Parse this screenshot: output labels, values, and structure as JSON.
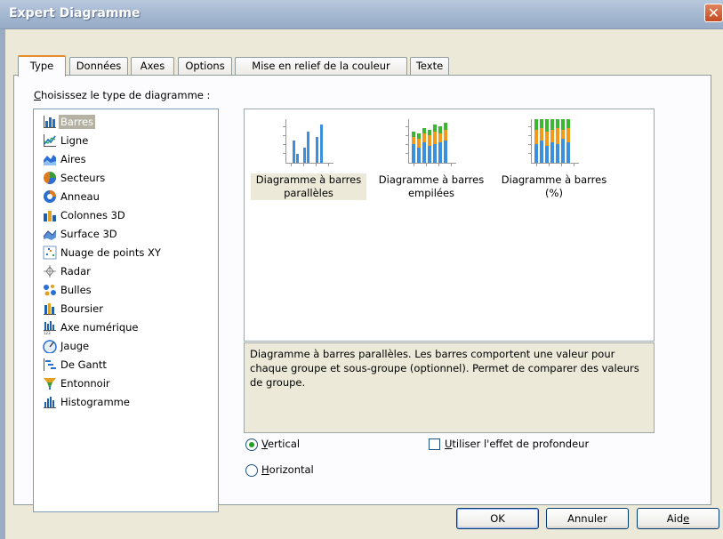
{
  "window": {
    "title": "Expert Diagramme",
    "close_label": "✕"
  },
  "tabs": [
    {
      "label": "Type",
      "active": true
    },
    {
      "label": "Données"
    },
    {
      "label": "Axes"
    },
    {
      "label": "Options"
    },
    {
      "label": "Mise en relief de la couleur"
    },
    {
      "label": "Texte"
    }
  ],
  "chart_type_label": "Choisissez le type de diagramme :",
  "chart_types": [
    {
      "label": "Barres",
      "icon": "bar-chart-icon",
      "selected": true
    },
    {
      "label": "Ligne",
      "icon": "line-chart-icon"
    },
    {
      "label": "Aires",
      "icon": "area-chart-icon"
    },
    {
      "label": "Secteurs",
      "icon": "pie-chart-icon"
    },
    {
      "label": "Anneau",
      "icon": "doughnut-chart-icon"
    },
    {
      "label": "Colonnes 3D",
      "icon": "3d-column-chart-icon"
    },
    {
      "label": "Surface 3D",
      "icon": "3d-surface-chart-icon"
    },
    {
      "label": "Nuage de points XY",
      "icon": "scatter-chart-icon"
    },
    {
      "label": "Radar",
      "icon": "radar-chart-icon"
    },
    {
      "label": "Bulles",
      "icon": "bubble-chart-icon"
    },
    {
      "label": "Boursier",
      "icon": "stock-chart-icon"
    },
    {
      "label": "Axe numérique",
      "icon": "numeric-axis-chart-icon"
    },
    {
      "label": "Jauge",
      "icon": "gauge-chart-icon"
    },
    {
      "label": "De Gantt",
      "icon": "gantt-chart-icon"
    },
    {
      "label": "Entonnoir",
      "icon": "funnel-chart-icon"
    },
    {
      "label": "Histogramme",
      "icon": "histogram-chart-icon"
    }
  ],
  "variants": [
    {
      "label": "Diagramme à barres parallèles",
      "line1": "Diagramme à barres",
      "line2": "parallèles",
      "selected": true
    },
    {
      "label": "Diagramme à barres empilées",
      "line1": "Diagramme à barres",
      "line2": "empilées"
    },
    {
      "label": "Diagramme à barres (%)",
      "line1": "Diagramme à barres",
      "line2": "(%)"
    }
  ],
  "description": "Diagramme à barres parallèles. Les barres comportent une valeur pour chaque groupe et sous-groupe (optionnel). Permet de comparer des valeurs de groupe.",
  "orientation": {
    "vertical_label": "Vertical",
    "horizontal_label": "Horizontal",
    "selected": "vertical"
  },
  "depth_effect": {
    "label": "Utiliser l'effet de profondeur",
    "checked": false
  },
  "buttons": {
    "ok": "OK",
    "cancel": "Annuler",
    "help": "Aide"
  },
  "colors": {
    "bar_blue": "#3a8fde",
    "bar_orange": "#f39a1b",
    "bar_green": "#3cb731",
    "selection": "#b5b2a4"
  }
}
